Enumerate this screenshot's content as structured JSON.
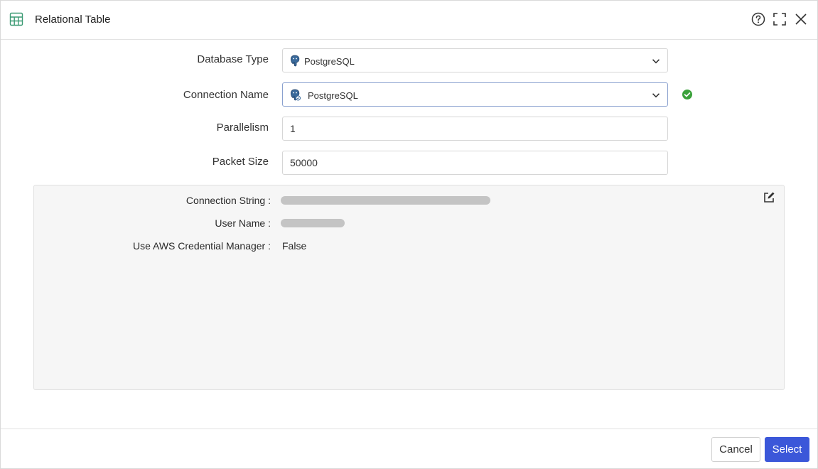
{
  "dialog": {
    "title": "Relational Table",
    "header_icons": [
      "table-icon",
      "help-icon",
      "fullscreen-icon",
      "close-icon"
    ]
  },
  "form": {
    "database_type": {
      "label": "Database Type",
      "value": "PostgreSQL",
      "icon": "postgresql-icon"
    },
    "connection_name": {
      "label": "Connection Name",
      "value": "PostgreSQL",
      "icon": "postgresql-icon",
      "status_icon": "check-circle-icon",
      "status_color": "#3aa13a"
    },
    "parallelism": {
      "label": "Parallelism",
      "value": "1"
    },
    "packet_size": {
      "label": "Packet Size",
      "value": "50000"
    }
  },
  "details": {
    "connection_string_label": "Connection String :",
    "user_name_label": "User Name :",
    "aws_label": "Use AWS Credential Manager :",
    "aws_value": "False",
    "edit_icon": "edit-icon"
  },
  "footer": {
    "cancel_label": "Cancel",
    "select_label": "Select"
  },
  "colors": {
    "primary": "#3b57d9",
    "table_icon": "#3a9a73"
  }
}
